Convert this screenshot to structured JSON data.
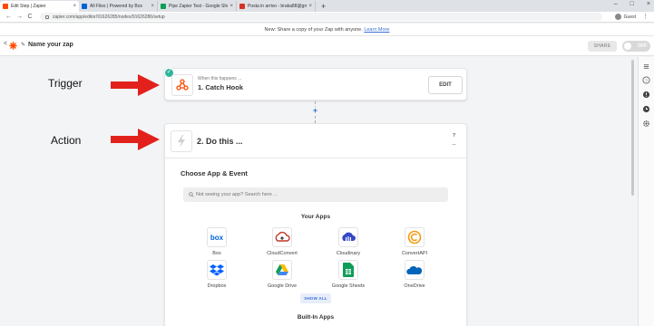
{
  "browser": {
    "tabs": [
      {
        "title": "Edit Step | Zapier",
        "favicon_color": "#ff4a00",
        "active": true
      },
      {
        "title": "All Files | Powered by Box",
        "favicon_color": "#0061d5",
        "active": false
      },
      {
        "title": "Pipe Zapier Test - Google Sheets",
        "favicon_color": "#0f9d58",
        "active": false
      },
      {
        "title": "Posta in arrivo - braka88@gmai...",
        "favicon_color": "#d93025",
        "active": false
      }
    ],
    "new_tab": "+",
    "window_controls": [
      "–",
      "□",
      "×"
    ],
    "nav": {
      "back": "←",
      "forward": "→",
      "reload": "C"
    },
    "url": "zapier.com/app/editor/91626285/nodes/91626286/setup",
    "profile": "Guest"
  },
  "notice": {
    "text": "New: Share a copy of your Zap with anyone. ",
    "link": "Learn More"
  },
  "zap_header": {
    "back": "<",
    "name": "Name your zap",
    "share_label": "SHARE",
    "toggle_label": "OFF",
    "toggle_on": false
  },
  "annotations": {
    "trigger": "Trigger",
    "action": "Action",
    "arrow_color": "#e2211c"
  },
  "trigger_card": {
    "subtitle": "When this happens ...",
    "title": "1. Catch Hook",
    "edit_label": "EDIT",
    "icon": "webhook-icon",
    "check_color": "#2fb39c"
  },
  "connector": {
    "plus": "+"
  },
  "action_card": {
    "title": "2. Do this ...",
    "help": "?",
    "more": "...",
    "choose_heading": "Choose App & Event",
    "search_placeholder": "Not seeing your app? Search here ...",
    "your_apps_heading": "Your Apps",
    "apps": [
      {
        "name": "Box",
        "icon": "box-icon"
      },
      {
        "name": "CloudConvert",
        "icon": "cloudconvert-icon"
      },
      {
        "name": "Cloudinary",
        "icon": "cloudinary-icon"
      },
      {
        "name": "ConvertAPI",
        "icon": "convertapi-icon"
      },
      {
        "name": "Dropbox",
        "icon": "dropbox-icon"
      },
      {
        "name": "Google Drive",
        "icon": "google-drive-icon"
      },
      {
        "name": "Google Sheets",
        "icon": "google-sheets-icon"
      },
      {
        "name": "OneDrive",
        "icon": "onedrive-icon"
      }
    ],
    "show_all_label": "SHOW ALL",
    "built_in_heading": "Built-In Apps"
  },
  "accent_color": "#3b6fd6"
}
